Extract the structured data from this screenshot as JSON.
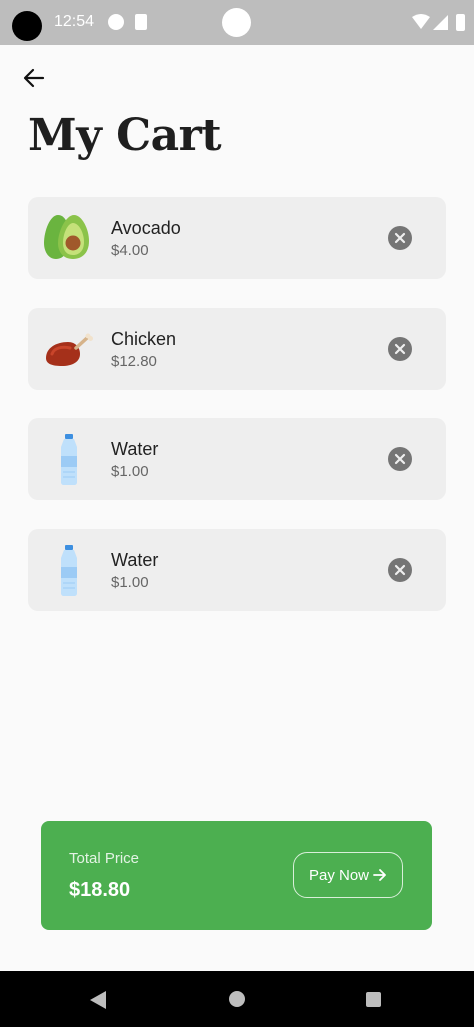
{
  "status_bar": {
    "time": "12:54",
    "icons": [
      "camera-cutout-icon",
      "app-notification-icon",
      "sd-card-icon",
      "wifi-icon",
      "signal-icon",
      "battery-icon"
    ]
  },
  "header": {
    "back_icon": "arrow-left-icon",
    "title": "My Cart"
  },
  "cart": {
    "items": [
      {
        "name": "Avocado",
        "price": "$4.00",
        "icon": "avocado-icon"
      },
      {
        "name": "Chicken",
        "price": "$12.80",
        "icon": "chicken-icon"
      },
      {
        "name": "Water",
        "price": "$1.00",
        "icon": "water-bottle-icon"
      },
      {
        "name": "Water",
        "price": "$1.00",
        "icon": "water-bottle-icon"
      }
    ],
    "remove_icon": "close-circle-icon"
  },
  "summary": {
    "label": "Total Price",
    "total": "$18.80",
    "pay_button_label": "Pay Now",
    "pay_icon": "arrow-right-icon"
  },
  "colors": {
    "accent": "#4caf50",
    "card_background": "#eeeeee",
    "page_background": "#fafafa",
    "status_bar": "#bdbdbd",
    "nav_bar": "#000000"
  },
  "nav_bar": {
    "icons": [
      "nav-back-icon",
      "nav-home-icon",
      "nav-recents-icon"
    ]
  }
}
